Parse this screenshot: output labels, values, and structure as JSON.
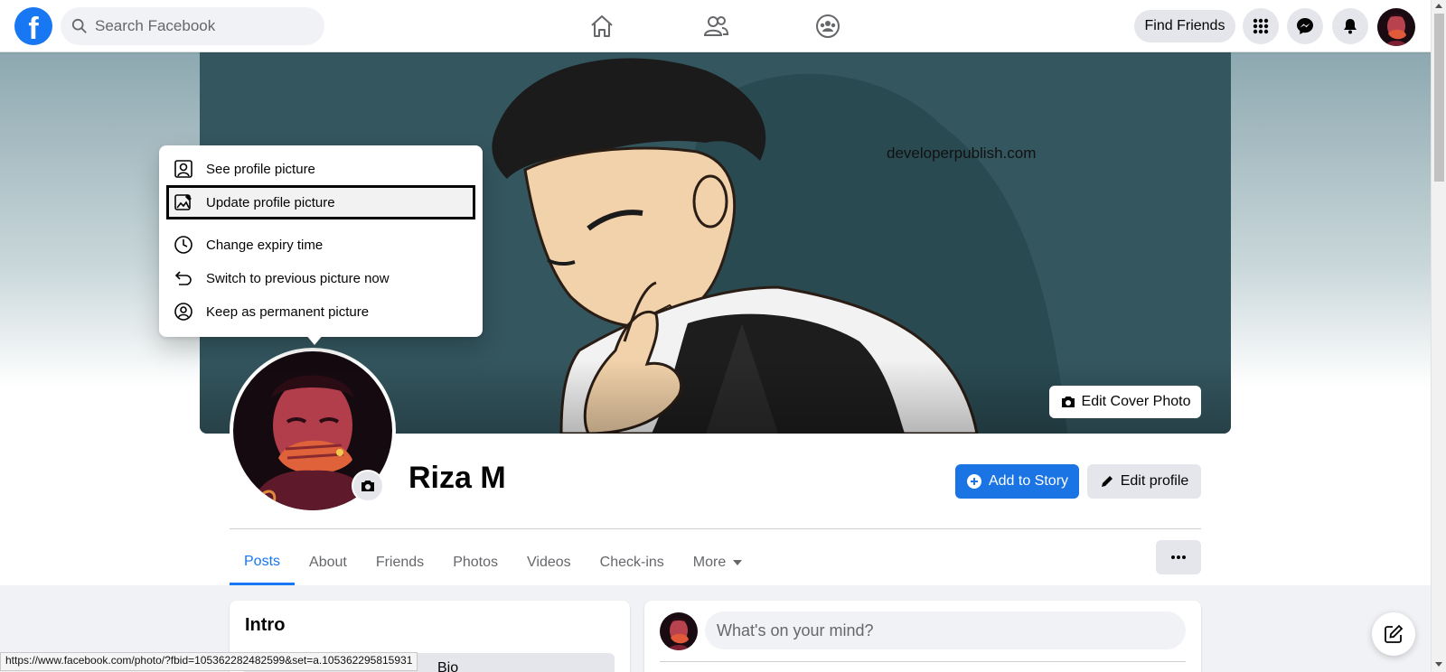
{
  "header": {
    "search_placeholder": "Search Facebook",
    "find_friends_label": "Find Friends"
  },
  "cover": {
    "watermark_text": "developerpublish.com",
    "edit_cover_label": "Edit Cover Photo"
  },
  "profile": {
    "name": "Riza M",
    "add_story_label": "Add to Story",
    "edit_profile_label": "Edit profile"
  },
  "tabs": [
    {
      "label": "Posts",
      "active": true
    },
    {
      "label": "About"
    },
    {
      "label": "Friends"
    },
    {
      "label": "Photos"
    },
    {
      "label": "Videos"
    },
    {
      "label": "Check-ins"
    },
    {
      "label": "More"
    }
  ],
  "menu": {
    "items": [
      {
        "label": "See profile picture",
        "icon": "person-frame-icon"
      },
      {
        "label": "Update profile picture",
        "icon": "image-edit-icon"
      },
      {
        "label": "Change expiry time",
        "icon": "clock-icon"
      },
      {
        "label": "Switch to previous picture now",
        "icon": "undo-icon"
      },
      {
        "label": "Keep as permanent picture",
        "icon": "person-circle-icon"
      }
    ]
  },
  "intro": {
    "title": "Intro",
    "bio_partial": "Bio"
  },
  "composer": {
    "placeholder": "What's on your mind?"
  },
  "status_bar": {
    "url": "https://www.facebook.com/photo/?fbid=105362282482599&set=a.105362295815931"
  },
  "colors": {
    "brand": "#1877f2",
    "cover_bg": "#34565f"
  }
}
